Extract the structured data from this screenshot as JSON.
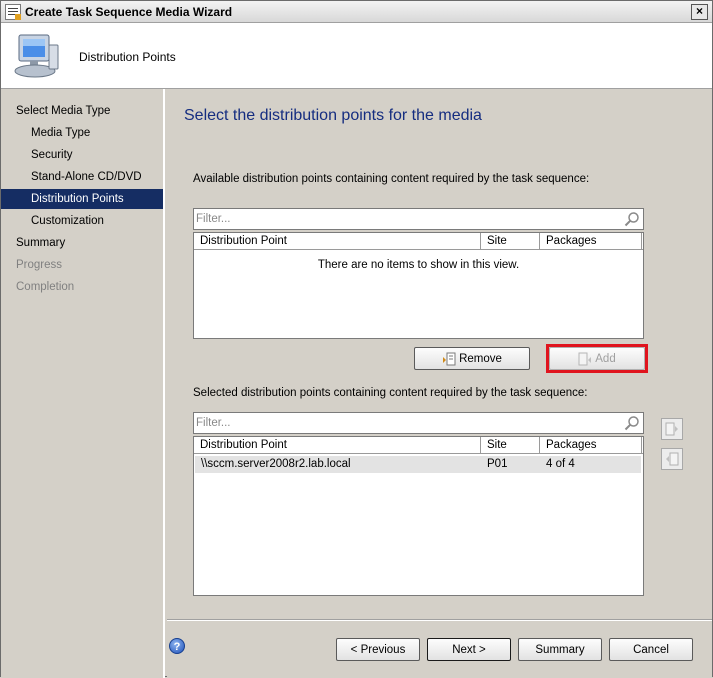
{
  "window": {
    "title": "Create Task Sequence Media Wizard",
    "close_label": "×"
  },
  "header": {
    "title": "Distribution Points",
    "icon": "computer-icon"
  },
  "nav": {
    "items": [
      {
        "label": "Select Media Type",
        "state": "normal"
      },
      {
        "label": "Media Type",
        "state": "normal"
      },
      {
        "label": "Security",
        "state": "normal"
      },
      {
        "label": "Stand-Alone CD/DVD",
        "state": "normal"
      },
      {
        "label": "Distribution Points",
        "state": "selected"
      },
      {
        "label": "Customization",
        "state": "normal"
      },
      {
        "label": "Summary",
        "state": "normal"
      },
      {
        "label": "Progress",
        "state": "disabled"
      },
      {
        "label": "Completion",
        "state": "disabled"
      }
    ]
  },
  "main": {
    "title": "Select the distribution points for the media",
    "available": {
      "label": "Available distribution points containing content required by the task sequence:",
      "filter_placeholder": "Filter...",
      "columns": [
        "Distribution Point",
        "Site",
        "Packages"
      ],
      "empty_message": "There are no items to show in this view."
    },
    "remove_label": "Remove",
    "add_label": "Add",
    "selected": {
      "label": "Selected distribution points containing content required by the task sequence:",
      "filter_placeholder": "Filter...",
      "columns": [
        "Distribution Point",
        "Site",
        "Packages"
      ],
      "rows": [
        {
          "point": "\\\\sccm.server2008r2.lab.local",
          "site": "P01",
          "packages": "4 of 4"
        }
      ]
    }
  },
  "footer": {
    "help_label": "?",
    "previous_label": "< Previous",
    "next_label": "Next >",
    "summary_label": "Summary",
    "cancel_label": "Cancel"
  },
  "colors": {
    "nav_selected": "#152d63",
    "title_blue": "#152d80",
    "highlight_red": "#e0141e"
  }
}
